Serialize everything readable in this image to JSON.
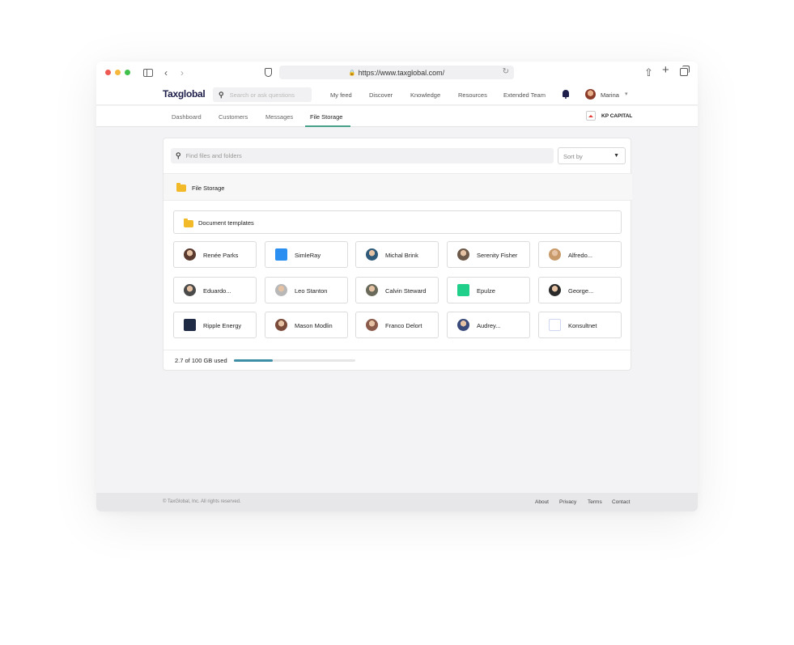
{
  "browser": {
    "url": "https://www.taxglobal.com/",
    "icons": [
      "sidebar-icon",
      "back-icon",
      "forward-icon",
      "shield-icon",
      "lock-icon",
      "reload-icon",
      "share-icon",
      "new-tab-icon",
      "tabs-icon"
    ]
  },
  "header": {
    "logo": "Taxglobal",
    "search_placeholder": "Search or ask questions",
    "nav": [
      "My feed",
      "Discover",
      "Knowledge",
      "Resources",
      "Extended Team"
    ],
    "user_name": "Marina"
  },
  "subnav": {
    "tabs": [
      "Dashboard",
      "Customers",
      "Messages",
      "File Storage"
    ],
    "active_tab": "File Storage",
    "company": "KP CAPITAL"
  },
  "file_storage": {
    "find_placeholder": "Find files and folders",
    "sort_label": "Sort by",
    "breadcrumb": "File Storage",
    "folder": "Document templates",
    "tiles": [
      {
        "label": "Renée Parks",
        "kind": "avatar",
        "color": "#5a3a2e"
      },
      {
        "label": "SimleRay",
        "kind": "logo",
        "color": "#2a8ff0"
      },
      {
        "label": "Michal Brink",
        "kind": "avatar",
        "color": "#2f5a7a"
      },
      {
        "label": "Serenity Fisher",
        "kind": "avatar",
        "color": "#6d5a4a"
      },
      {
        "label": "Alfredo...",
        "kind": "avatar",
        "color": "#c89a6a"
      },
      {
        "label": "Eduardo...",
        "kind": "avatar",
        "color": "#4a4a4a"
      },
      {
        "label": "Leo Stanton",
        "kind": "avatar",
        "color": "#b8b8b8"
      },
      {
        "label": "Calvin Steward",
        "kind": "avatar",
        "color": "#6a6a5a"
      },
      {
        "label": "Epulze",
        "kind": "logo",
        "color": "#1fcf8a"
      },
      {
        "label": "George...",
        "kind": "avatar",
        "color": "#2a2a2a"
      },
      {
        "label": "Ripple Energy",
        "kind": "logo",
        "color": "#1f2a44"
      },
      {
        "label": "Mason Modlin",
        "kind": "avatar",
        "color": "#7a4a3a"
      },
      {
        "label": "Franco Delort",
        "kind": "avatar",
        "color": "#8a5a4a"
      },
      {
        "label": "Audrey...",
        "kind": "avatar",
        "color": "#3a4a7a"
      },
      {
        "label": "Konsultnet",
        "kind": "logo",
        "color": "#ffffff"
      }
    ],
    "storage_text": "2.7 of 100 GB used",
    "storage_used_fraction": 0.32
  },
  "footer": {
    "copyright": "© TaxGlobal, Inc. All rights reserved.",
    "links": [
      "About",
      "Privacy",
      "Terms",
      "Contact"
    ]
  }
}
